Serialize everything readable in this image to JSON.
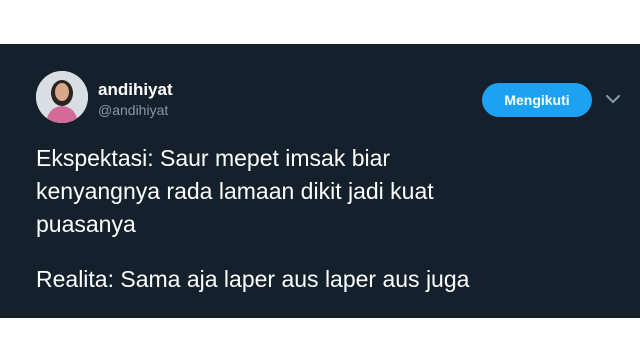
{
  "tweet": {
    "author": {
      "display_name": "andihiyat",
      "handle": "@andihiyat",
      "avatar_icon": "user-avatar"
    },
    "follow_button_label": "Mengikuti",
    "menu_icon": "chevron-down-icon",
    "text": {
      "line1": "Ekspektasi: Saur mepet imsak biar",
      "line2": "kenyangnya rada lamaan dikit jadi kuat",
      "line3": "puasanya",
      "line4": "Realita: Sama aja laper aus laper aus juga"
    }
  },
  "colors": {
    "background": "#14202b",
    "accent": "#1da1f2",
    "secondary_text": "#8899a6"
  }
}
